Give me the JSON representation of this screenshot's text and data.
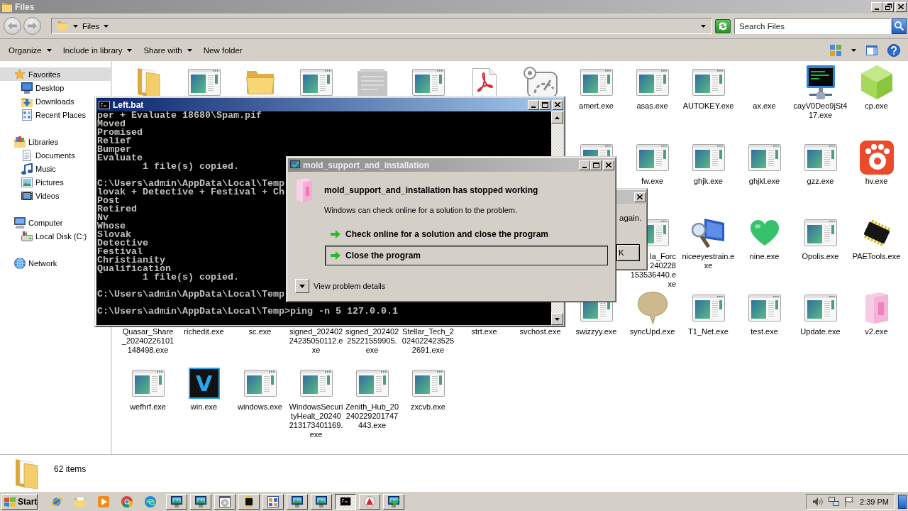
{
  "explorer": {
    "title": "Files",
    "active": false,
    "nav_buttons": [
      {
        "kind": "back",
        "disabled": true
      },
      {
        "kind": "forward",
        "disabled": true
      }
    ],
    "breadcrumb": [
      "Files"
    ],
    "search": {
      "placeholder": "Search Files"
    },
    "toolbar": [
      {
        "label": "Organize",
        "dropdown": true
      },
      {
        "label": "Include in library",
        "dropdown": true
      },
      {
        "label": "Share with",
        "dropdown": true
      },
      {
        "label": "New folder",
        "dropdown": false
      }
    ],
    "sidebar": [
      {
        "label": "Favorites",
        "kind": "favorites",
        "selected": true,
        "children": [
          {
            "label": "Desktop",
            "kind": "desktop",
            "selected": false
          },
          {
            "label": "Downloads",
            "kind": "downloads",
            "selected": false
          },
          {
            "label": "Recent Places",
            "kind": "recent",
            "selected": false
          }
        ]
      },
      {
        "label": "Libraries",
        "kind": "libraries",
        "selected": false,
        "children": [
          {
            "label": "Documents",
            "kind": "documents",
            "selected": false
          },
          {
            "label": "Music",
            "kind": "music",
            "selected": false
          },
          {
            "label": "Pictures",
            "kind": "pictures",
            "selected": false
          },
          {
            "label": "Videos",
            "kind": "videos",
            "selected": false
          }
        ]
      },
      {
        "label": "Computer",
        "kind": "computer",
        "selected": false,
        "children": [
          {
            "label": "Local Disk (C:)",
            "kind": "drive",
            "selected": false
          }
        ]
      },
      {
        "label": "Network",
        "kind": "network",
        "selected": false
      }
    ],
    "file_rows": [
      {
        "items": [
          {
            "kind": "folder"
          },
          {
            "kind": "program"
          },
          {
            "kind": "foldertab"
          },
          {
            "kind": "program"
          },
          {
            "kind": "faded"
          },
          {
            "kind": "program"
          },
          {
            "kind": "pdf"
          },
          {
            "kind": "gauge"
          },
          {
            "kind": "program",
            "label": "amert.exe"
          },
          {
            "kind": "program",
            "label": "asas.exe"
          },
          {
            "kind": "program",
            "label": "AUTOKEY.exe"
          },
          {
            "label": "ax.exe"
          },
          {
            "kind": "terminal",
            "label": "cayV0Deo9jSt417.exe"
          },
          {
            "kind": "cube",
            "label": "cp.exe"
          }
        ]
      },
      {
        "leading_hidden": true,
        "items": [
          {
            "kind": "program"
          },
          {
            "kind": "program",
            "label": "fw.exe"
          },
          {
            "kind": "program",
            "label": "ghjk.exe"
          },
          {
            "kind": "program",
            "label": "ghjkl.exe"
          },
          {
            "kind": "program",
            "label": "gzz.exe"
          },
          {
            "kind": "paw",
            "label": "hv.exe"
          }
        ]
      },
      {
        "leading_hidden": true,
        "items": [
          {
            "kind": "program",
            "label": "la_Forc\n240228\n153536440.e\nxe",
            "cut_off": true
          },
          {
            "kind": "magnifier",
            "label": "niceeyestrain.exe"
          },
          {
            "kind": "heart",
            "label": "nine.exe"
          },
          {
            "kind": "program",
            "label": "Opolis.exe"
          },
          {
            "kind": "chip",
            "label": "PAETools.exe"
          }
        ]
      },
      {
        "items": [
          {
            "label": "Quasar_Share_20240226101148498.exe"
          },
          {
            "label": "richedit.exe"
          },
          {
            "label": "sc.exe"
          },
          {
            "label": "signed_20240224235050112.exe"
          },
          {
            "label": "signed_20240225221559905.exe"
          },
          {
            "label": "Stellar_Tech_20240224235252691.exe"
          },
          {
            "label": "strt.exe"
          },
          {
            "label": "svchost.exe"
          },
          {
            "kind": "program",
            "label": "swizzyy.exe"
          },
          {
            "kind": "bubble",
            "label": "syncUpd.exe"
          },
          {
            "kind": "program",
            "label": "T1_Net.exe"
          },
          {
            "kind": "program",
            "label": "test.exe"
          },
          {
            "kind": "program",
            "label": "Update.exe"
          },
          {
            "kind": "box",
            "label": "v2.exe"
          }
        ]
      },
      {
        "leading_hidden": false,
        "items": [
          {
            "kind": "program",
            "label": "wefhrf.exe"
          },
          {
            "kind": "logo",
            "glyph": "V",
            "label": "win.exe"
          },
          {
            "kind": "program",
            "label": "windows.exe"
          },
          {
            "kind": "program",
            "label": "WindowsSecurityHealt_20240213173401169.exe"
          },
          {
            "kind": "program",
            "label": "Zenith_Hub_20240229201747443.exe"
          },
          {
            "kind": "program",
            "label": "zxcvb.exe"
          }
        ]
      }
    ],
    "status": "62 items"
  },
  "console": {
    "title": "Left.bat",
    "active": true,
    "blocks": [
      [
        "per + Evaluate 18680\\Spam.pif",
        "Moved",
        "Promised",
        "Relief",
        "Bumper",
        "Evaluate",
        "        1 file(s) copied."
      ],
      [
        "C:\\Users\\admin\\AppData\\Local\\Temp",
        "lovak + Detective + Festival + Ch",
        "Post",
        "Retired",
        "Nv",
        "Whose",
        "Slovak",
        "Detective",
        "Festival",
        "Christianity",
        "Qualification",
        "        1 file(s) copied."
      ],
      [
        "C:\\Users\\admin\\AppData\\Local\\Temp"
      ],
      [
        "C:\\Users\\admin\\AppData\\Local\\Temp>ping -n 5 127.0.0.1"
      ]
    ]
  },
  "error_dialog": {
    "title": "mold_support_and_installation",
    "active": false,
    "heading": "mold_support_and_installation has stopped working",
    "message": "Windows can check online for a solution to the problem.",
    "options": [
      {
        "label": "Check online for a solution and close the program",
        "selected": false
      },
      {
        "label": "Close the program",
        "selected": true
      }
    ],
    "details": {
      "label": "View problem details",
      "expanded": false
    }
  },
  "back_dialog": {
    "active": false,
    "message": "again.",
    "button": "K"
  },
  "taskbar": {
    "start": "Start",
    "quick_launch": [
      {
        "kind": "globe"
      },
      {
        "kind": "folders"
      },
      {
        "kind": "media"
      },
      {
        "kind": "ring"
      },
      {
        "kind": "swirl"
      }
    ],
    "tasks": [
      {
        "kind": "setup",
        "selected": false
      },
      {
        "kind": "setup",
        "selected": false
      },
      {
        "kind": "disc",
        "selected": false
      },
      {
        "kind": "chip",
        "selected": false
      },
      {
        "kind": "grid",
        "selected": false
      },
      {
        "kind": "setup",
        "selected": false
      },
      {
        "kind": "setup",
        "selected": false
      },
      {
        "kind": "console",
        "selected": true
      },
      {
        "kind": "logo",
        "selected": false
      },
      {
        "kind": "check",
        "selected": false
      }
    ],
    "clock": "2:39 PM"
  }
}
